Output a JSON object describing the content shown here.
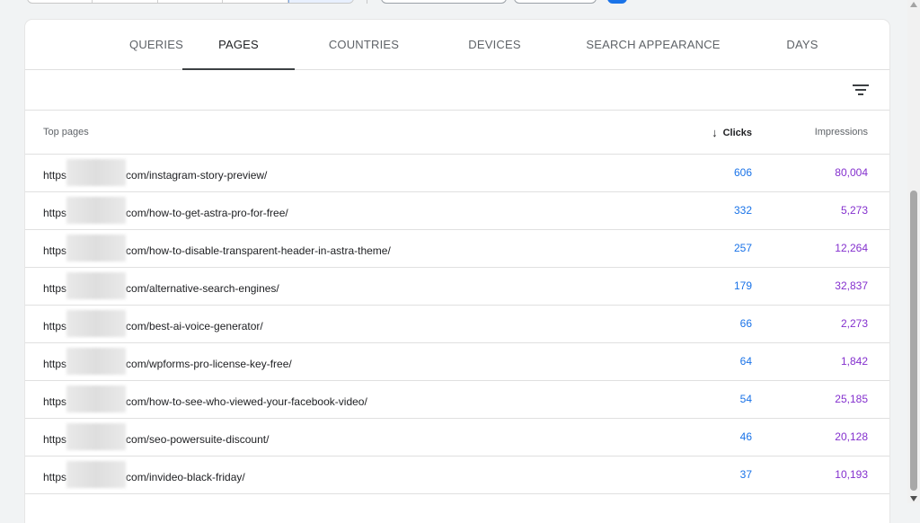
{
  "tabs": [
    {
      "label": "QUERIES",
      "active": false
    },
    {
      "label": "PAGES",
      "active": true
    },
    {
      "label": "COUNTRIES",
      "active": false
    },
    {
      "label": "DEVICES",
      "active": false
    },
    {
      "label": "SEARCH APPEARANCE",
      "active": false
    },
    {
      "label": "DAYS",
      "active": false
    }
  ],
  "filter": {
    "icon": "filter-list-icon"
  },
  "table": {
    "col_page": "Top pages",
    "col_clicks": "Clicks",
    "col_impressions": "Impressions",
    "sort_icon": "arrow-down-icon",
    "rows": [
      {
        "prefix": "https",
        "path": "com/instagram-story-preview/",
        "clicks": "606",
        "impressions": "80,004"
      },
      {
        "prefix": "https",
        "path": "com/how-to-get-astra-pro-for-free/",
        "clicks": "332",
        "impressions": "5,273"
      },
      {
        "prefix": "https",
        "path": "com/how-to-disable-transparent-header-in-astra-theme/",
        "clicks": "257",
        "impressions": "12,264"
      },
      {
        "prefix": "https",
        "path": "com/alternative-search-engines/",
        "clicks": "179",
        "impressions": "32,837"
      },
      {
        "prefix": "https",
        "path": "com/best-ai-voice-generator/",
        "clicks": "66",
        "impressions": "2,273"
      },
      {
        "prefix": "https",
        "path": "com/wpforms-pro-license-key-free/",
        "clicks": "64",
        "impressions": "1,842"
      },
      {
        "prefix": "https",
        "path": "com/how-to-see-who-viewed-your-facebook-video/",
        "clicks": "54",
        "impressions": "25,185"
      },
      {
        "prefix": "https",
        "path": "com/seo-powersuite-discount/",
        "clicks": "46",
        "impressions": "20,128"
      },
      {
        "prefix": "https",
        "path": "com/invideo-black-friday/",
        "clicks": "37",
        "impressions": "10,193"
      }
    ]
  },
  "colors": {
    "clicks": "#1a73e8",
    "impressions": "#8430ce",
    "apply_button": "#1a73e8"
  }
}
